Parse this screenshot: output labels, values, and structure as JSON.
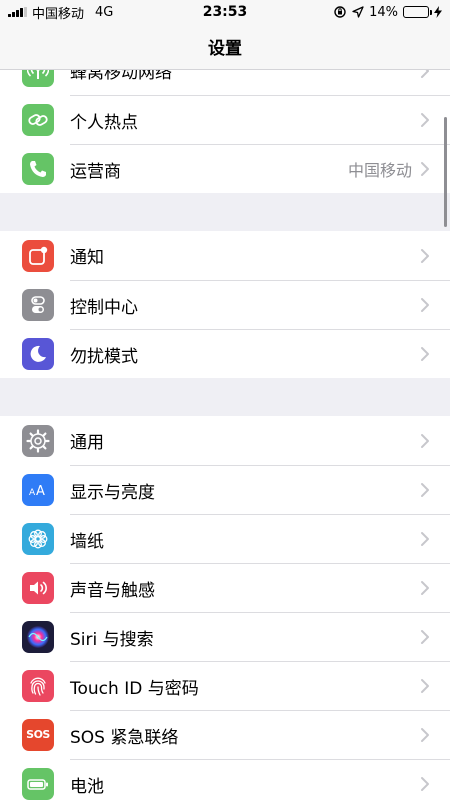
{
  "statusbar": {
    "carrier": "中国移动",
    "network": "4G",
    "time": "23:53",
    "battery_percent": "14%",
    "battery_level": 0.14,
    "battery_color": "#f5c542"
  },
  "navbar": {
    "title": "设置"
  },
  "groups": [
    {
      "items": [
        {
          "label": "蜂窝移动网络",
          "icon": "cellular-icon",
          "color": "#65c466"
        },
        {
          "label": "个人热点",
          "icon": "hotspot-icon",
          "color": "#65c466"
        },
        {
          "label": "运营商",
          "value": "中国移动",
          "icon": "phone-icon",
          "color": "#65c466"
        }
      ]
    },
    {
      "items": [
        {
          "label": "通知",
          "icon": "notifications-icon",
          "color": "#eb4d3d"
        },
        {
          "label": "控制中心",
          "icon": "control-center-icon",
          "color": "#8e8e93"
        },
        {
          "label": "勿扰模式",
          "icon": "moon-icon",
          "color": "#5856d6"
        }
      ]
    },
    {
      "items": [
        {
          "label": "通用",
          "icon": "gear-icon",
          "color": "#8e8e93"
        },
        {
          "label": "显示与亮度",
          "icon": "display-icon",
          "color": "#2f7cf6"
        },
        {
          "label": "墙纸",
          "icon": "wallpaper-icon",
          "color": "#34aadc"
        },
        {
          "label": "声音与触感",
          "icon": "sound-icon",
          "color": "#eb4760"
        },
        {
          "label": "Siri 与搜索",
          "icon": "siri-icon",
          "color": "#1c1c3a"
        },
        {
          "label": "Touch ID 与密码",
          "icon": "fingerprint-icon",
          "color": "#eb4760"
        },
        {
          "label": "SOS 紧急联络",
          "icon": "sos-icon",
          "color": "#e5472d",
          "icon_text": "SOS"
        },
        {
          "label": "电池",
          "icon": "battery-icon",
          "color": "#65c466"
        }
      ]
    }
  ]
}
